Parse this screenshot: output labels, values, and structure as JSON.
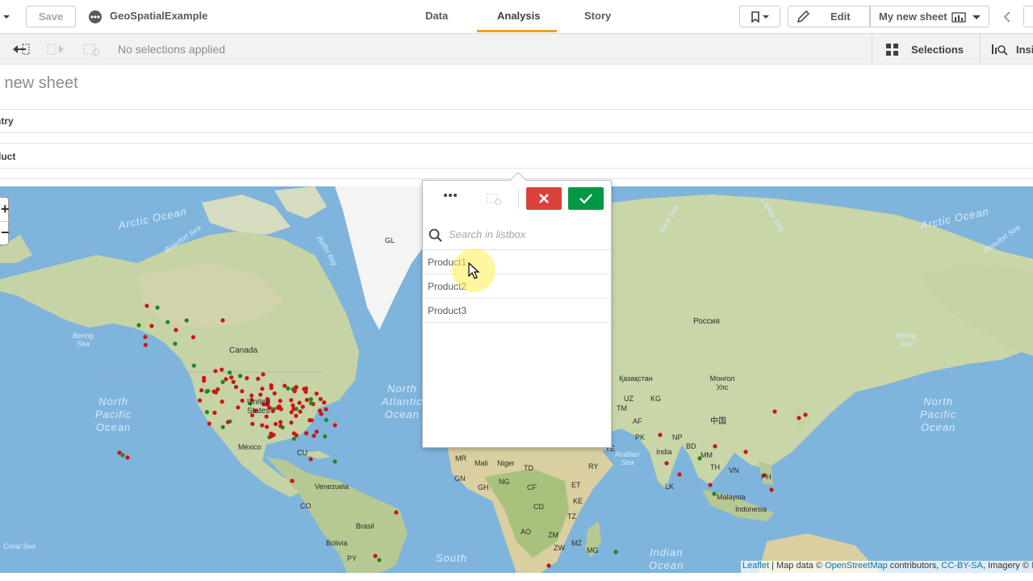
{
  "toolbar": {
    "save_label": "Save",
    "app_name": "GeoSpatialExample",
    "tabs": [
      "Data",
      "Analysis",
      "Story"
    ],
    "active_tab": "Analysis",
    "edit_label": "Edit",
    "sheet_label": "My new sheet",
    "accent_color": "#f0a020"
  },
  "selections_bar": {
    "status": "No selections applied",
    "selections_label": "Selections",
    "insights_label": "Insi"
  },
  "sheet": {
    "title": "y new sheet",
    "filters": [
      "ntry",
      "duct"
    ]
  },
  "listbox": {
    "search_placeholder": "Search in listbox",
    "items": [
      "Product1",
      "Product2",
      "Product3"
    ],
    "cancel_color": "#dc423c",
    "confirm_color": "#009845"
  },
  "map": {
    "labels": {
      "gl": "GL",
      "canada": "Canada",
      "united_states": "United States",
      "mexico": "México",
      "cu": "CU",
      "venezuela": "Venezuela",
      "co": "CO",
      "brasil": "Brasil",
      "bolivia": "Bolivia",
      "py": "PY",
      "russia": "Россия",
      "kazakhstan": "Қазақстан",
      "mongolia": "Монгол Улс",
      "uz": "UZ",
      "kg": "KG",
      "tm": "TM",
      "af": "AF",
      "pk": "PK",
      "china": "中国",
      "india": "India",
      "np": "NP",
      "bd": "BD",
      "mm": "MM",
      "th": "TH",
      "vn": "VN",
      "ph": "PH",
      "lk": "LK",
      "malaysia": "Malaysia",
      "indonesia": "Indonesia",
      "mr": "MR",
      "mali": "Mali",
      "niger": "Niger",
      "td": "TD",
      "gn": "GN",
      "gh": "GH",
      "ng": "NG",
      "cf": "CF",
      "et": "ET",
      "ke": "KE",
      "cd": "CD",
      "tz": "TZ",
      "ao": "AO",
      "zm": "ZM",
      "mz": "MZ",
      "zw": "ZW",
      "mg": "MG",
      "ye": "YE",
      "ry": "RY"
    },
    "oceans": {
      "arctic_left": "Arctic Ocean",
      "arctic_right": "Arctic Ocean",
      "north_pacific_left": "North\nPacific\nOcean",
      "north_pacific_right": "North\nPacific\nOcean",
      "north_atlantic": "North\nAtlantic\nOcean",
      "indian": "Indian\nOcean",
      "south": "South",
      "beaufort": "Beaufort Sea",
      "bering": "Bering\nSea",
      "coral": "Coral Sea",
      "arabian": "Arabian\nSea",
      "baffin": "Baffin Bay",
      "kara": "Kara Sea",
      "laptev": "Laptev Sea",
      "beaufort_right": "Beaufort Sea",
      "bering_right": "Bering\nSea"
    },
    "attribution": {
      "leaflet": "Leaflet",
      "sep": " | Map data © ",
      "osm": "OpenStreetMap",
      "contrib": " contributors, ",
      "license": "CC-BY-SA",
      "imagery": ", Imagery © ",
      "mapbox": "Ma"
    },
    "zoom_in": "+",
    "zoom_out": "−",
    "point_colors": {
      "red": "#cc1414",
      "green": "#1e8a1e"
    }
  }
}
